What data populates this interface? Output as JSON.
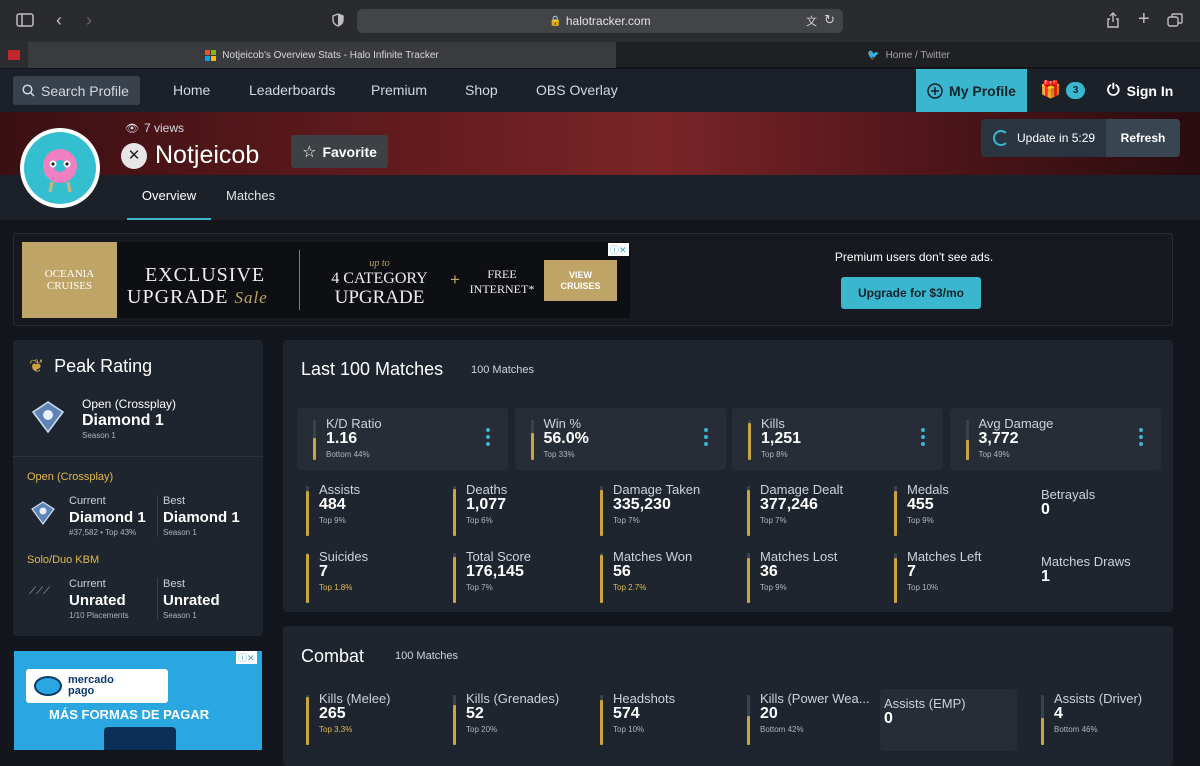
{
  "browser": {
    "url": "halotracker.com",
    "tabs": [
      {
        "title": "Notjeicob's Overview Stats - Halo Infinite Tracker"
      },
      {
        "title": "Home / Twitter"
      }
    ]
  },
  "nav": {
    "search": "Search Profile",
    "links": [
      "Home",
      "Leaderboards",
      "Premium",
      "Shop",
      "OBS Overlay"
    ],
    "my_profile": "My Profile",
    "gift_count": "3",
    "sign_in": "Sign In"
  },
  "profile": {
    "views": "7 views",
    "name": "Notjeicob",
    "favorite": "Favorite",
    "update": "Update in 5:29",
    "refresh": "Refresh",
    "tabs": [
      "Overview",
      "Matches"
    ]
  },
  "ad": {
    "brand": "OCEANIA CRUISES",
    "line1": "EXCLUSIVE",
    "line2": "UPGRADE",
    "sale": "Sale",
    "upto": "up to",
    "category1": "4 CATEGORY",
    "category2": "UPGRADE",
    "plus": "+",
    "internet1": "FREE",
    "internet2": "INTERNET*",
    "cta1": "VIEW",
    "cta2": "CRUISES",
    "premium_note": "Premium users don't see ads.",
    "upgrade": "Upgrade for $3/mo"
  },
  "peak": {
    "title": "Peak Rating",
    "playlist": "Open (Crossplay)",
    "rank": "Diamond 1",
    "season": "Season 1",
    "groups": [
      {
        "name": "Open (Crossplay)",
        "current_label": "Current",
        "current": "Diamond 1",
        "current_sub": "#37,582 • Top 43%",
        "best_label": "Best",
        "best": "Diamond 1",
        "best_sub": "Season 1"
      },
      {
        "name": "Solo/Duo KBM",
        "current_label": "Current",
        "current": "Unrated",
        "current_sub": "1/10 Placements",
        "best_label": "Best",
        "best": "Unrated",
        "best_sub": "Season 1"
      }
    ]
  },
  "ad2": {
    "brand1": "mercado",
    "brand2": "pago",
    "text": "MÁS FORMAS DE PAGAR"
  },
  "last100": {
    "title": "Last 100 Matches",
    "subtitle": "100 Matches",
    "main": [
      {
        "label": "K/D Ratio",
        "value": "1.16",
        "rank": "Bottom 44%",
        "pct": 0.56
      },
      {
        "label": "Win %",
        "value": "56.0%",
        "rank": "Top 33%",
        "pct": 0.67
      },
      {
        "label": "Kills",
        "value": "1,251",
        "rank": "Top 8%",
        "pct": 0.92
      },
      {
        "label": "Avg Damage",
        "value": "3,772",
        "rank": "Top 49%",
        "pct": 0.51
      }
    ],
    "row1": [
      {
        "label": "Assists",
        "value": "484",
        "rank": "Top 9%",
        "pct": 0.91
      },
      {
        "label": "Deaths",
        "value": "1,077",
        "rank": "Top 6%",
        "pct": 0.94
      },
      {
        "label": "Damage Taken",
        "value": "335,230",
        "rank": "Top 7%",
        "pct": 0.93
      },
      {
        "label": "Damage Dealt",
        "value": "377,246",
        "rank": "Top 7%",
        "pct": 0.93
      },
      {
        "label": "Medals",
        "value": "455",
        "rank": "Top 9%",
        "pct": 0.91
      },
      {
        "label": "Betrayals",
        "value": "0",
        "rank": "",
        "pct": 0
      }
    ],
    "row2": [
      {
        "label": "Suicides",
        "value": "7",
        "rank": "Top 1.8%",
        "pct": 0.98
      },
      {
        "label": "Total Score",
        "value": "176,145",
        "rank": "Top 7%",
        "pct": 0.93
      },
      {
        "label": "Matches Won",
        "value": "56",
        "rank": "Top 2.7%",
        "pct": 0.97
      },
      {
        "label": "Matches Lost",
        "value": "36",
        "rank": "Top 9%",
        "pct": 0.91
      },
      {
        "label": "Matches Left",
        "value": "7",
        "rank": "Top 10%",
        "pct": 0.9
      },
      {
        "label": "Matches Draws",
        "value": "1",
        "rank": "",
        "pct": 0
      }
    ]
  },
  "combat": {
    "title": "Combat",
    "subtitle": "100 Matches",
    "row1": [
      {
        "label": "Kills (Melee)",
        "value": "265",
        "rank": "Top 3.3%",
        "pct": 0.97
      },
      {
        "label": "Kills (Grenades)",
        "value": "52",
        "rank": "Top 20%",
        "pct": 0.8
      },
      {
        "label": "Headshots",
        "value": "574",
        "rank": "Top 10%",
        "pct": 0.9
      },
      {
        "label": "Kills (Power Wea...",
        "value": "20",
        "rank": "Bottom 42%",
        "pct": 0.58
      },
      {
        "label": "Assists (EMP)",
        "value": "0",
        "rank": "",
        "pct": 0
      },
      {
        "label": "Assists (Driver)",
        "value": "4",
        "rank": "Bottom 46%",
        "pct": 0.54
      }
    ]
  }
}
